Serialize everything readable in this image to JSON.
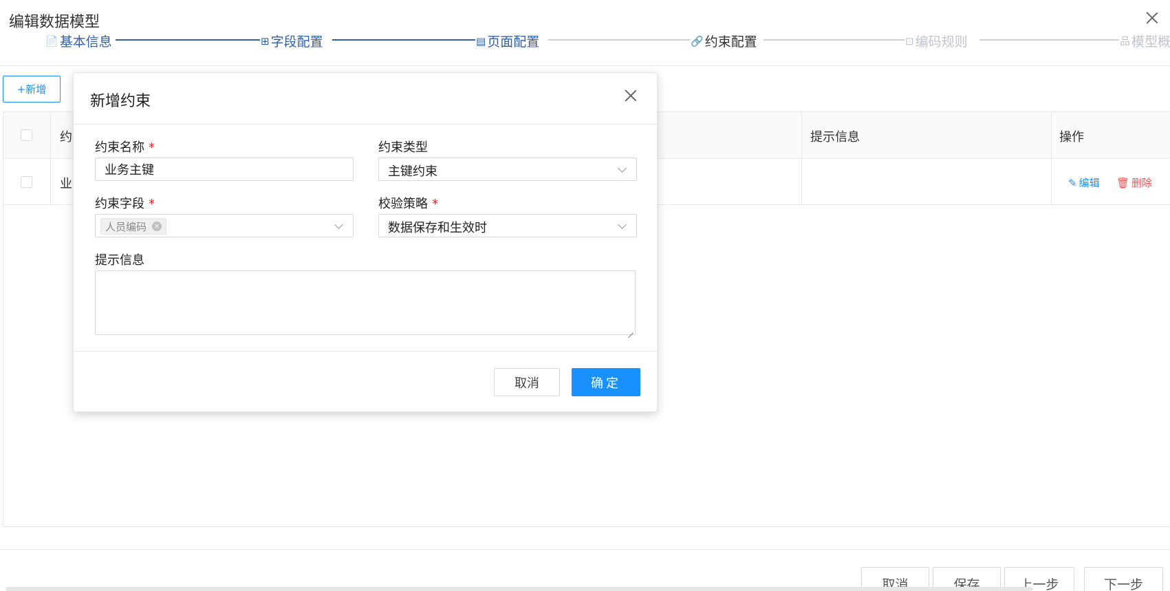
{
  "header": {
    "title": "编辑数据模型"
  },
  "steps": [
    {
      "label": "基本信息",
      "icon": "📄",
      "state": "done"
    },
    {
      "label": "字段配置",
      "icon": "⊞",
      "state": "done"
    },
    {
      "label": "页面配置",
      "icon": "▤",
      "state": "done"
    },
    {
      "label": "约束配置",
      "icon": "🔗",
      "state": "active"
    },
    {
      "label": "编码规则",
      "icon": "⊡",
      "state": "todo"
    },
    {
      "label": "模型概",
      "icon": "品",
      "state": "todo"
    }
  ],
  "toolbar": {
    "add_label": "+新增"
  },
  "table": {
    "columns": [
      "约束",
      "提示信息",
      "操作"
    ],
    "rows": [
      {
        "name": "业务"
      }
    ],
    "actions": {
      "edit": "编辑",
      "delete": "删除"
    }
  },
  "footer": {
    "cancel": "取消",
    "save": "保存",
    "prev": "上一步",
    "next": "下一步"
  },
  "modal": {
    "title": "新增约束",
    "fields": {
      "name_label": "约束名称",
      "name_value": "业务主键",
      "type_label": "约束类型",
      "type_value": "主键约束",
      "field_label": "约束字段",
      "field_tag": "人员编码",
      "strategy_label": "校验策略",
      "strategy_value": "数据保存和生效时",
      "hint_label": "提示信息",
      "required_mark": "*"
    },
    "buttons": {
      "cancel": "取消",
      "ok": "确定"
    }
  },
  "colors": {
    "primary": "#1890ff",
    "step_done": "#2f5fad",
    "danger": "#ff4d4f"
  }
}
